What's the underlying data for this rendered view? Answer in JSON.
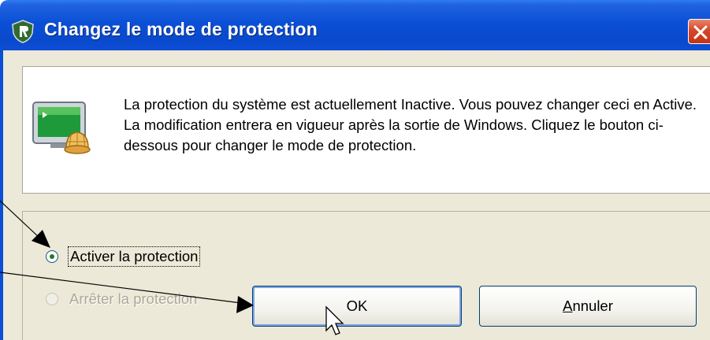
{
  "window": {
    "title": "Changez le mode de protection",
    "title_bar_color": "#0b4fd6",
    "close_button_color": "#d6462a"
  },
  "message": {
    "icon": "monitor-with-shell-icon",
    "text": "La protection du système est actuellement Inactive. Vous pouvez changer ceci en Active. La modification entrera en vigueur après la sortie de Windows. Cliquez le bouton ci-dessous pour changer le mode de protection."
  },
  "options": {
    "activate": {
      "label": "Activer la protection",
      "selected": true,
      "enabled": true
    },
    "stop": {
      "label": "Arrêter la protection",
      "selected": false,
      "enabled": false
    }
  },
  "buttons": {
    "ok": "OK",
    "cancel_accel": "A",
    "cancel_rest": "nnuler"
  }
}
